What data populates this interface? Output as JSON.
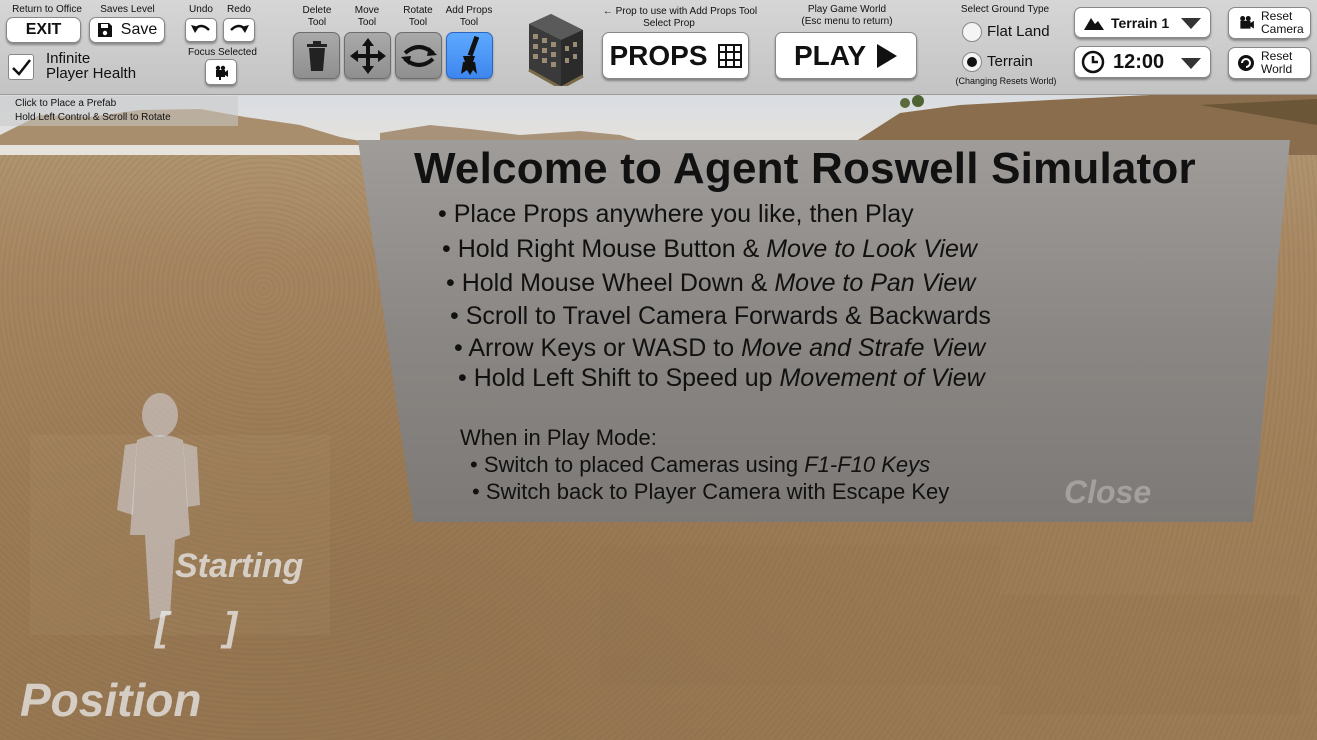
{
  "toolbar": {
    "exit": {
      "caption": "Return to Office",
      "label": "EXIT"
    },
    "save": {
      "caption": "Saves Level",
      "label": "Save"
    },
    "undo": {
      "caption": "Undo"
    },
    "redo": {
      "caption": "Redo"
    },
    "focus": {
      "caption": "Focus Selected"
    },
    "infinite_health": {
      "label_line1": "Infinite",
      "label_line2": "Player Health",
      "checked": true
    },
    "tools": {
      "delete": {
        "caption_line1": "Delete",
        "caption_line2": "Tool"
      },
      "move": {
        "caption_line1": "Move",
        "caption_line2": "Tool"
      },
      "rotate": {
        "caption_line1": "Rotate",
        "caption_line2": "Tool"
      },
      "add_props": {
        "caption_line1": "Add Props",
        "caption_line2": "Tool",
        "active": true
      }
    },
    "props": {
      "caption_line1": "← Prop to use with Add Props Tool",
      "caption_line2": "Select Prop",
      "label": "PROPS"
    },
    "play": {
      "caption_line1": "Play Game World",
      "caption_line2": "(Esc menu to return)",
      "label": "PLAY"
    },
    "ground": {
      "caption": "Select Ground Type",
      "options": [
        "Flat Land",
        "Terrain"
      ],
      "selected": "Terrain",
      "note": "(Changing Resets World)"
    },
    "terrain_select": {
      "value": "Terrain 1"
    },
    "time_select": {
      "value": "12:00"
    },
    "reset_camera": {
      "line1": "Reset",
      "line2": "Camera"
    },
    "reset_world": {
      "line1": "Reset",
      "line2": "World"
    }
  },
  "hint": {
    "line1": "Click to Place a Prefab",
    "line2": "Hold Left Control & Scroll to Rotate"
  },
  "welcome": {
    "title": "Welcome to Agent Roswell Simulator",
    "bullets": [
      {
        "a": "Place Props anywhere you like, then Play",
        "b": ""
      },
      {
        "a": "Hold Right Mouse Button & ",
        "b": "Move to Look View"
      },
      {
        "a": "Hold Mouse Wheel Down & ",
        "b": "Move to Pan View"
      },
      {
        "a": "Scroll to Travel Camera Forwards & Backwards",
        "b": ""
      },
      {
        "a": "Arrow Keys or WASD to ",
        "b": "Move and Strafe View"
      },
      {
        "a": "Hold Left Shift to Speed up ",
        "b": "Movement of View"
      }
    ],
    "play_heading": "When in Play Mode:",
    "play_bullets": [
      {
        "a": "Switch to placed Cameras using ",
        "b": "F1-F10 Keys"
      },
      {
        "a": "Switch back to Player Camera with Escape Key",
        "b": ""
      }
    ],
    "close": "Close"
  },
  "start_marker": {
    "word1": "Starting",
    "brackets": "[     ]",
    "word2": "Position"
  },
  "colors": {
    "active_tool": "#3d86ee",
    "toolbar_bg": "#c8c8c8",
    "panel_bg": "#8b8784"
  }
}
